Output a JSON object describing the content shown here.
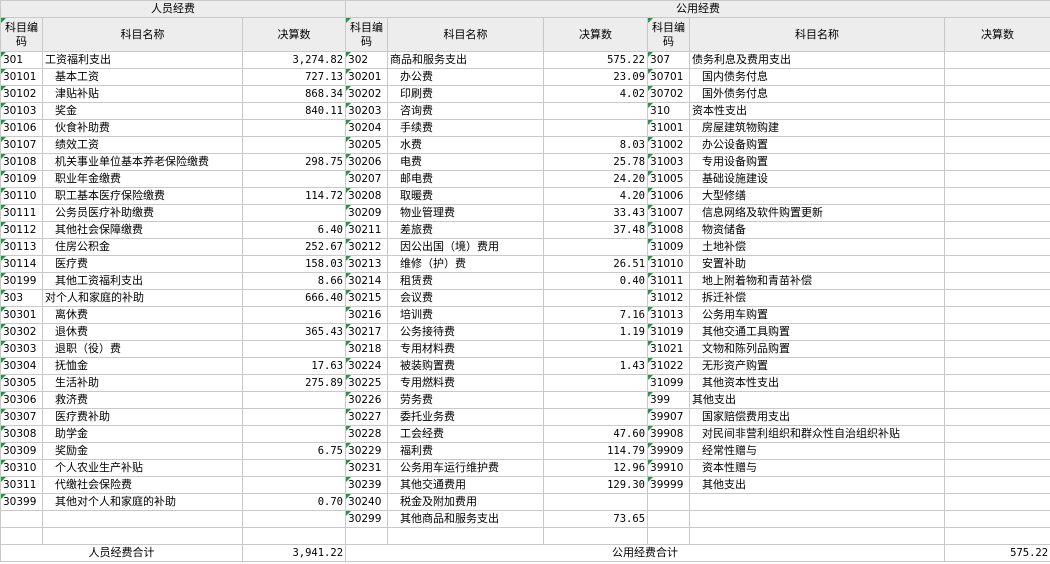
{
  "groups": {
    "personnel": "人员经费",
    "public": "公用经费"
  },
  "headers": {
    "code": "科目编码",
    "name": "科目名称",
    "amount": "决算数"
  },
  "personnel_rows": [
    {
      "code": "301",
      "name": "工资福利支出",
      "amount": "3,274.82",
      "level": 1
    },
    {
      "code": "30101",
      "name": "基本工资",
      "amount": "727.13",
      "level": 2
    },
    {
      "code": "30102",
      "name": "津贴补贴",
      "amount": "868.34",
      "level": 2
    },
    {
      "code": "30103",
      "name": "奖金",
      "amount": "840.11",
      "level": 2
    },
    {
      "code": "30106",
      "name": "伙食补助费",
      "amount": "",
      "level": 2
    },
    {
      "code": "30107",
      "name": "绩效工资",
      "amount": "",
      "level": 2
    },
    {
      "code": "30108",
      "name": "机关事业单位基本养老保险缴费",
      "amount": "298.75",
      "level": 2
    },
    {
      "code": "30109",
      "name": "职业年金缴费",
      "amount": "",
      "level": 2
    },
    {
      "code": "30110",
      "name": "职工基本医疗保险缴费",
      "amount": "114.72",
      "level": 2
    },
    {
      "code": "30111",
      "name": "公务员医疗补助缴费",
      "amount": "",
      "level": 2
    },
    {
      "code": "30112",
      "name": "其他社会保障缴费",
      "amount": "6.40",
      "level": 2
    },
    {
      "code": "30113",
      "name": "住房公积金",
      "amount": "252.67",
      "level": 2
    },
    {
      "code": "30114",
      "name": "医疗费",
      "amount": "158.03",
      "level": 2
    },
    {
      "code": "30199",
      "name": "其他工资福利支出",
      "amount": "8.66",
      "level": 2
    },
    {
      "code": "303",
      "name": "对个人和家庭的补助",
      "amount": "666.40",
      "level": 1
    },
    {
      "code": "30301",
      "name": "离休费",
      "amount": "",
      "level": 2
    },
    {
      "code": "30302",
      "name": "退休费",
      "amount": "365.43",
      "level": 2
    },
    {
      "code": "30303",
      "name": "退职（役）费",
      "amount": "",
      "level": 2
    },
    {
      "code": "30304",
      "name": "抚恤金",
      "amount": "17.63",
      "level": 2
    },
    {
      "code": "30305",
      "name": "生活补助",
      "amount": "275.89",
      "level": 2
    },
    {
      "code": "30306",
      "name": "救济费",
      "amount": "",
      "level": 2
    },
    {
      "code": "30307",
      "name": "医疗费补助",
      "amount": "",
      "level": 2
    },
    {
      "code": "30308",
      "name": "助学金",
      "amount": "",
      "level": 2
    },
    {
      "code": "30309",
      "name": "奖励金",
      "amount": "6.75",
      "level": 2
    },
    {
      "code": "30310",
      "name": "个人农业生产补贴",
      "amount": "",
      "level": 2
    },
    {
      "code": "30311",
      "name": "代缴社会保险费",
      "amount": "",
      "level": 2
    },
    {
      "code": "30399",
      "name": "其他对个人和家庭的补助",
      "amount": "0.70",
      "level": 2
    }
  ],
  "goods_rows": [
    {
      "code": "302",
      "name": "商品和服务支出",
      "amount": "575.22",
      "level": 1
    },
    {
      "code": "30201",
      "name": "办公费",
      "amount": "23.09",
      "level": 2
    },
    {
      "code": "30202",
      "name": "印刷费",
      "amount": "4.02",
      "level": 2
    },
    {
      "code": "30203",
      "name": "咨询费",
      "amount": "",
      "level": 2
    },
    {
      "code": "30204",
      "name": "手续费",
      "amount": "",
      "level": 2
    },
    {
      "code": "30205",
      "name": "水费",
      "amount": "8.03",
      "level": 2
    },
    {
      "code": "30206",
      "name": "电费",
      "amount": "25.78",
      "level": 2
    },
    {
      "code": "30207",
      "name": "邮电费",
      "amount": "24.20",
      "level": 2
    },
    {
      "code": "30208",
      "name": "取暖费",
      "amount": "4.20",
      "level": 2
    },
    {
      "code": "30209",
      "name": "物业管理费",
      "amount": "33.43",
      "level": 2
    },
    {
      "code": "30211",
      "name": "差旅费",
      "amount": "37.48",
      "level": 2
    },
    {
      "code": "30212",
      "name": "因公出国（境）费用",
      "amount": "",
      "level": 2
    },
    {
      "code": "30213",
      "name": "维修（护）费",
      "amount": "26.51",
      "level": 2
    },
    {
      "code": "30214",
      "name": "租赁费",
      "amount": "0.40",
      "level": 2
    },
    {
      "code": "30215",
      "name": "会议费",
      "amount": "",
      "level": 2
    },
    {
      "code": "30216",
      "name": "培训费",
      "amount": "7.16",
      "level": 2
    },
    {
      "code": "30217",
      "name": "公务接待费",
      "amount": "1.19",
      "level": 2
    },
    {
      "code": "30218",
      "name": "专用材料费",
      "amount": "",
      "level": 2
    },
    {
      "code": "30224",
      "name": "被装购置费",
      "amount": "1.43",
      "level": 2
    },
    {
      "code": "30225",
      "name": "专用燃料费",
      "amount": "",
      "level": 2
    },
    {
      "code": "30226",
      "name": "劳务费",
      "amount": "",
      "level": 2
    },
    {
      "code": "30227",
      "name": "委托业务费",
      "amount": "",
      "level": 2
    },
    {
      "code": "30228",
      "name": "工会经费",
      "amount": "47.60",
      "level": 2
    },
    {
      "code": "30229",
      "name": "福利费",
      "amount": "114.79",
      "level": 2
    },
    {
      "code": "30231",
      "name": "公务用车运行维护费",
      "amount": "12.96",
      "level": 2
    },
    {
      "code": "30239",
      "name": "其他交通费用",
      "amount": "129.30",
      "level": 2
    },
    {
      "code": "30240",
      "name": "税金及附加费用",
      "amount": "",
      "level": 2
    },
    {
      "code": "30299",
      "name": "其他商品和服务支出",
      "amount": "73.65",
      "level": 2
    }
  ],
  "capital_rows": [
    {
      "code": "307",
      "name": "债务利息及费用支出",
      "amount": "",
      "level": 1
    },
    {
      "code": "30701",
      "name": "国内债务付息",
      "amount": "",
      "level": 2
    },
    {
      "code": "30702",
      "name": "国外债务付息",
      "amount": "",
      "level": 2
    },
    {
      "code": "310",
      "name": "资本性支出",
      "amount": "",
      "level": 1
    },
    {
      "code": "31001",
      "name": "房屋建筑物购建",
      "amount": "",
      "level": 2
    },
    {
      "code": "31002",
      "name": "办公设备购置",
      "amount": "",
      "level": 2
    },
    {
      "code": "31003",
      "name": "专用设备购置",
      "amount": "",
      "level": 2
    },
    {
      "code": "31005",
      "name": "基础设施建设",
      "amount": "",
      "level": 2
    },
    {
      "code": "31006",
      "name": "大型修缮",
      "amount": "",
      "level": 2
    },
    {
      "code": "31007",
      "name": "信息网络及软件购置更新",
      "amount": "",
      "level": 2
    },
    {
      "code": "31008",
      "name": "物资储备",
      "amount": "",
      "level": 2
    },
    {
      "code": "31009",
      "name": "土地补偿",
      "amount": "",
      "level": 2
    },
    {
      "code": "31010",
      "name": "安置补助",
      "amount": "",
      "level": 2
    },
    {
      "code": "31011",
      "name": "地上附着物和青苗补偿",
      "amount": "",
      "level": 2
    },
    {
      "code": "31012",
      "name": "拆迁补偿",
      "amount": "",
      "level": 2
    },
    {
      "code": "31013",
      "name": "公务用车购置",
      "amount": "",
      "level": 2
    },
    {
      "code": "31019",
      "name": "其他交通工具购置",
      "amount": "",
      "level": 2
    },
    {
      "code": "31021",
      "name": "文物和陈列品购置",
      "amount": "",
      "level": 2
    },
    {
      "code": "31022",
      "name": "无形资产购置",
      "amount": "",
      "level": 2
    },
    {
      "code": "31099",
      "name": "其他资本性支出",
      "amount": "",
      "level": 2
    },
    {
      "code": "399",
      "name": "其他支出",
      "amount": "",
      "level": 1
    },
    {
      "code": "39907",
      "name": "国家赔偿费用支出",
      "amount": "",
      "level": 2
    },
    {
      "code": "39908",
      "name": "对民间非营利组织和群众性自治组织补贴",
      "amount": "",
      "level": 2
    },
    {
      "code": "39909",
      "name": "经常性赠与",
      "amount": "",
      "level": 2
    },
    {
      "code": "39910",
      "name": "资本性赠与",
      "amount": "",
      "level": 2
    },
    {
      "code": "39999",
      "name": "其他支出",
      "amount": "",
      "level": 2
    }
  ],
  "totals": {
    "personnel_label": "人员经费合计",
    "personnel_value": "3,941.22",
    "public_label": "公用经费合计",
    "public_value": "575.22"
  },
  "accent": {
    "marker": "#1a9b3c",
    "header_bg": "#ededed",
    "gridline": "#c9c9c9"
  }
}
